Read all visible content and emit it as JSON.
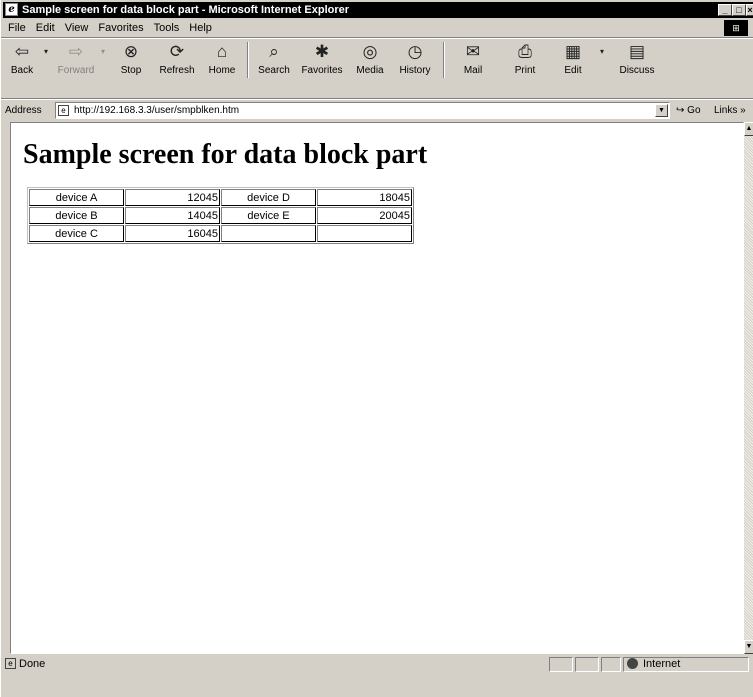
{
  "window": {
    "title": "Sample screen for data block part - Microsoft Internet Explorer",
    "controls": [
      "_",
      "□",
      "×"
    ]
  },
  "menu": [
    "File",
    "Edit",
    "View",
    "Favorites",
    "Tools",
    "Help"
  ],
  "toolbar": {
    "back": "Back",
    "forward": "Forward",
    "stop": "Stop",
    "refresh": "Refresh",
    "home": "Home",
    "search": "Search",
    "favorites": "Favorites",
    "media": "Media",
    "history": "History",
    "mail": "Mail",
    "print": "Print",
    "edit": "Edit",
    "discuss": "Discuss"
  },
  "address": {
    "label": "Address",
    "url": "http://192.168.3.3/user/smpblken.htm",
    "go": "Go",
    "links": "Links"
  },
  "page": {
    "heading": "Sample screen for data block part",
    "table": [
      [
        "device A",
        "12045",
        "device D",
        "18045"
      ],
      [
        "device B",
        "14045",
        "device E",
        "20045"
      ],
      [
        "device C",
        "16045",
        "",
        ""
      ]
    ]
  },
  "status": {
    "text": "Done",
    "zone": "Internet"
  },
  "icons": {
    "back": "back-arrow-icon",
    "forward": "forward-arrow-icon",
    "stop": "stop-icon",
    "refresh": "refresh-icon",
    "home": "home-icon",
    "search": "search-icon",
    "favorites": "favorites-icon",
    "media": "media-icon",
    "history": "history-icon",
    "mail": "mail-icon",
    "print": "print-icon",
    "edit": "edit-icon",
    "discuss": "discuss-icon"
  }
}
